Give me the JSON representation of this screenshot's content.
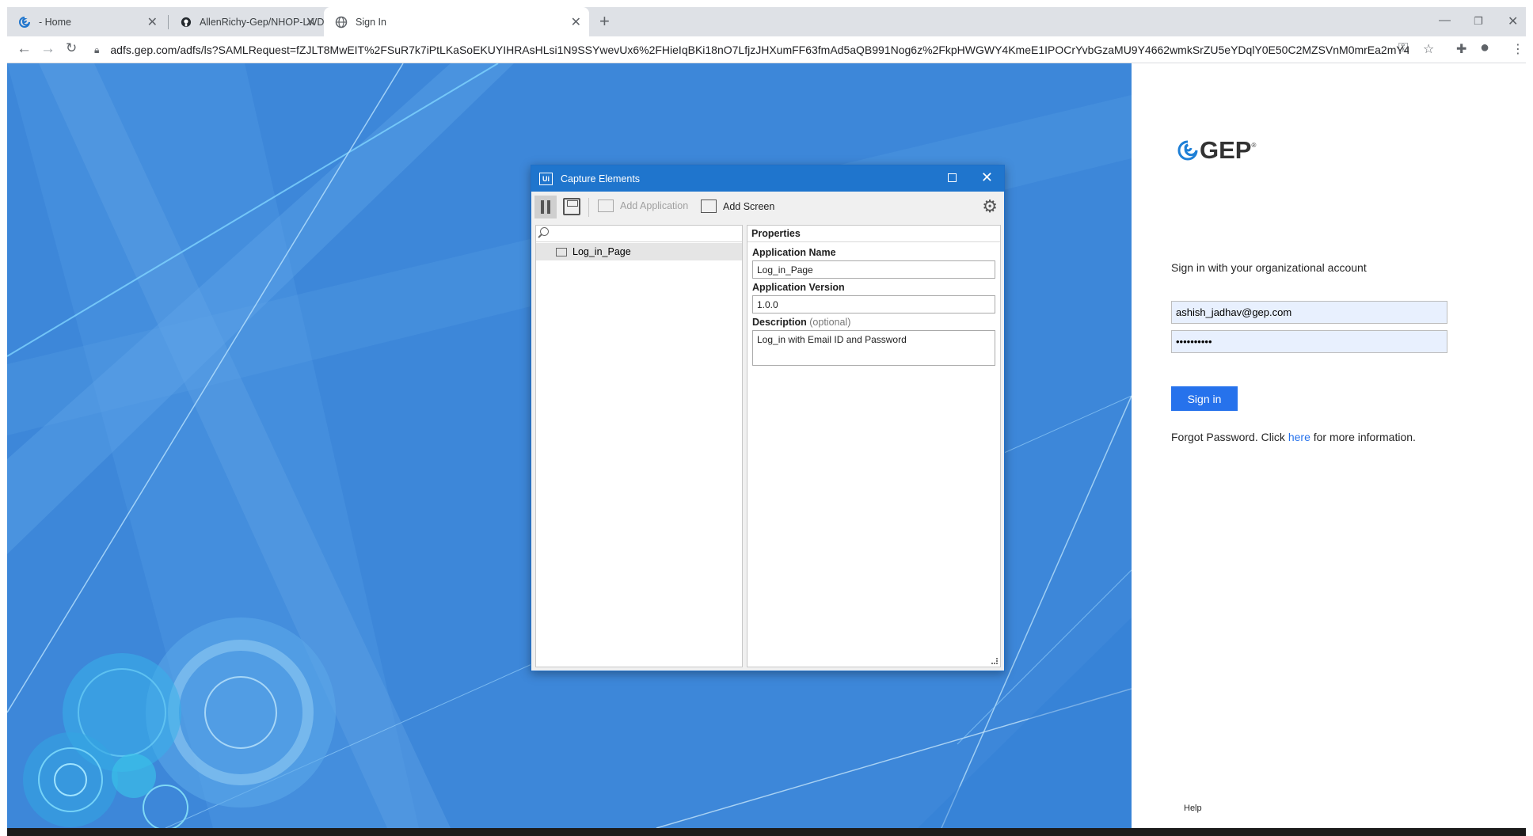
{
  "browser": {
    "tabs": [
      {
        "title": "- Home",
        "active": false
      },
      {
        "title": "AllenRichy-Gep/NHOP-LWD-Aut",
        "active": false
      },
      {
        "title": "Sign In",
        "active": true
      }
    ],
    "url": "adfs.gep.com/adfs/ls?SAMLRequest=fZJLT8MwEIT%2FSuR7k7iPtLKaSoEKUYIHRAsHLsi1N9SSYwevUx6%2FHieIqBKi18nO7LfjzJHXumFF63fmAd5aQB991Nog6z%2FkpHWGWY4KmeE1IPOCrYvbGzaMU9Y4662wmkSrZU5eYDqlY0E50C2MZSVnM0mrEa2mY4BxNUI..."
  },
  "login": {
    "logo_text": "GEP",
    "logo_reg": "®",
    "heading": "Sign in with your organizational account",
    "email_value": "ashish_jadhav@gep.com",
    "password_value": "••••••••••",
    "signin_label": "Sign in",
    "forgot_prefix": "Forgot Password. Click ",
    "forgot_link": "here",
    "forgot_suffix": " for more information.",
    "help_label": "Help"
  },
  "dialog": {
    "title": "Capture Elements",
    "app_icon_text": "Ui",
    "toolbar": {
      "add_application_label": "Add Application",
      "add_screen_label": "Add Screen"
    },
    "tree": {
      "items": [
        "Log_in_Page"
      ]
    },
    "properties": {
      "header": "Properties",
      "app_name_label": "Application Name",
      "app_name_value": "Log_in_Page",
      "app_version_label": "Application Version",
      "app_version_value": "1.0.0",
      "description_label": "Description",
      "description_optional": "(optional)",
      "description_value": "Log_in with Email ID and Password"
    }
  },
  "colors": {
    "background_blue": "#3d87d9",
    "signin_button": "#2672ec",
    "dialog_titlebar": "#1f75cd"
  }
}
